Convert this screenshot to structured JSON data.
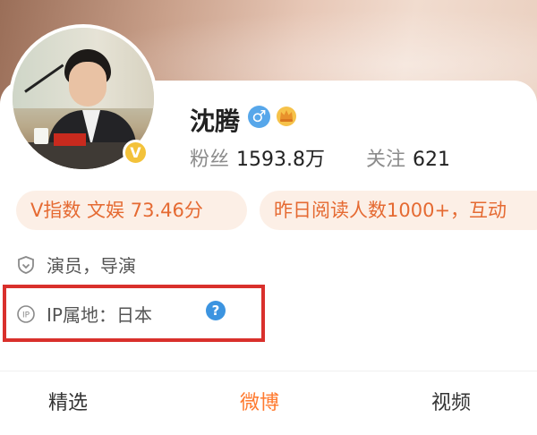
{
  "profile": {
    "name": "沈腾",
    "verified_badge": "V",
    "gender_symbol": "♂",
    "gender_color": "#57a7ea",
    "crown_icon": "crown-icon"
  },
  "stats": {
    "followers_label": "粉丝",
    "followers_value": "1593.8万",
    "following_label": "关注",
    "following_value": "621"
  },
  "tags": {
    "v_index": "V指数 文娱 73.46分",
    "reads": "昨日阅读人数1000+，互动"
  },
  "info": {
    "occupation": "演员，导演",
    "ip_location": "IP属地：日本",
    "help_symbol": "?"
  },
  "tabs": [
    {
      "label": "精选",
      "active": false
    },
    {
      "label": "微博",
      "active": true
    },
    {
      "label": "视频",
      "active": false
    }
  ],
  "colors": {
    "accent": "#ff7a2f",
    "tag_text": "#e56a32",
    "tag_bg": "#fcefe6",
    "highlight": "#d9302c",
    "verified": "#f3c23a"
  }
}
